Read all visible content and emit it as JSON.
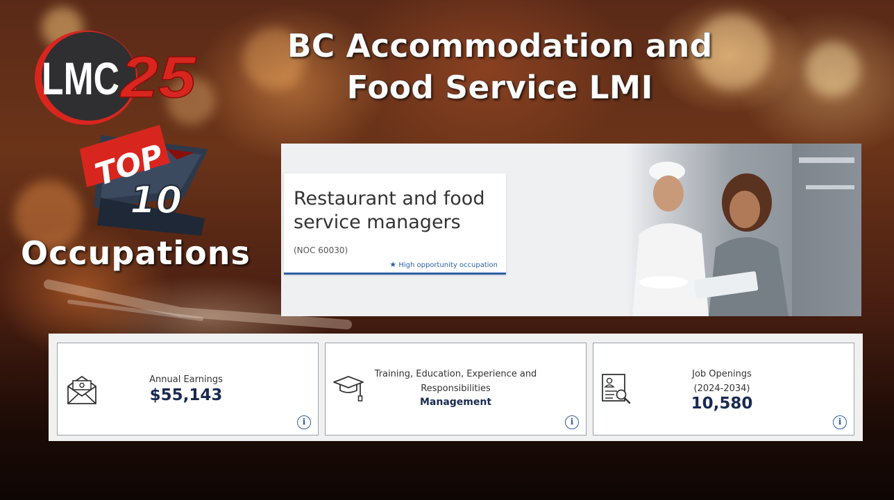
{
  "slide": {
    "title_line1": "BC Accommodation and",
    "title_line2": "Food Service LMI",
    "logo_text_left": "LMC",
    "logo_text_right": "25",
    "badge_top": "TOP",
    "badge_number": "10",
    "occupations_label": "Occupations"
  },
  "occupation": {
    "title": "Restaurant and food service managers",
    "noc": "(NOC 60030)",
    "opportunity": "High opportunity occupation"
  },
  "stats": [
    {
      "icon": "envelope-money-icon",
      "label": "Annual Earnings",
      "value": "$55,143"
    },
    {
      "icon": "graduation-cap-icon",
      "label": "Training, Education, Experience and Responsibilities",
      "value": "Management"
    },
    {
      "icon": "document-search-icon",
      "label": "Job Openings",
      "sublabel": "(2024-2034)",
      "value": "10,580"
    }
  ],
  "colors": {
    "accent": "#2b5fa4",
    "value_text": "#1a2a50",
    "logo_red": "#d8261f",
    "logo_dark": "#2f2f31"
  }
}
